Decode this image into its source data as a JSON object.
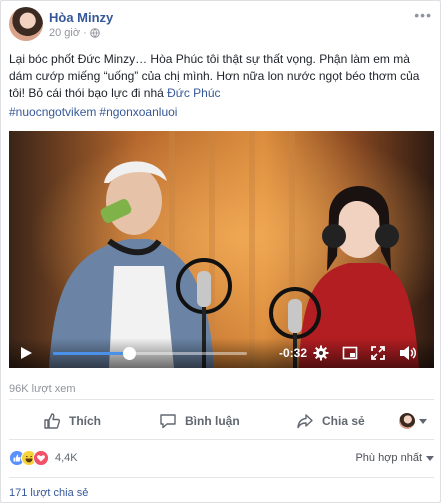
{
  "post": {
    "author": "Hòa Minzy",
    "time": "20 giờ",
    "text_before": "Lại bóc phốt Đức Minzy… Hòa Phúc tôi thật sự thất vọng. Phận làm em mà dám cướp miếng “uống” của chị mình. Hơn nữa lon nước ngọt béo thơm của tôi! Bỏ cái thói bạo lực đi nhá ",
    "mention": "Đức Phúc",
    "hashtags": [
      "#nuocngotvikem",
      "#ngonxoanluoi"
    ]
  },
  "video": {
    "time_remaining": "-0:32",
    "progress": 0.39
  },
  "stats": {
    "views": "96K lượt xem",
    "reactions_count": "4,4K",
    "shares": "171 lượt chia sẻ",
    "sort_label": "Phù hợp nhất"
  },
  "actions": {
    "like": "Thích",
    "comment": "Bình luận",
    "share": "Chia sẻ"
  },
  "colors": {
    "link": "#365899",
    "progress": "#4a8fe8",
    "like_reaction": "#5890ff",
    "love_reaction": "#f25268",
    "haha_reaction": "#f7d33b"
  }
}
